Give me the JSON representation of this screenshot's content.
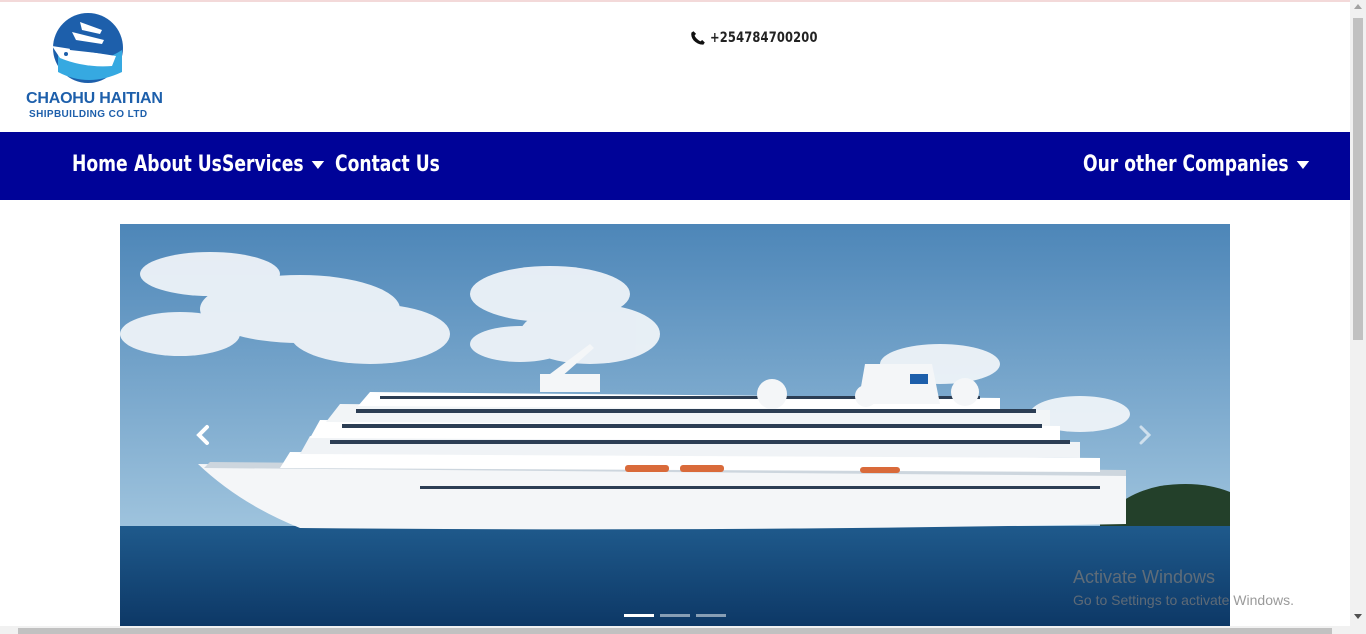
{
  "header": {
    "logo": {
      "name": "CHAOHU HAITIAN",
      "subtitle": "SHIPBUILDING  CO LTD"
    },
    "phone": {
      "icon": "phone-icon",
      "number": "+254784700200"
    }
  },
  "nav": {
    "background": "#000398",
    "items": [
      {
        "label": "Home",
        "dropdown": false
      },
      {
        "label": "About Us",
        "dropdown": false
      },
      {
        "label": "Services",
        "dropdown": true
      },
      {
        "label": "Contact Us",
        "dropdown": true
      }
    ],
    "right_item": {
      "label": "Our other Companies",
      "dropdown": true
    }
  },
  "carousel": {
    "prev_icon": "chevron-left-icon",
    "next_icon": "chevron-right-icon",
    "slide_count": 3,
    "active_slide": 1
  },
  "watermark": {
    "title": "Activate Windows",
    "subtitle": "Go to Settings to activate Windows."
  }
}
